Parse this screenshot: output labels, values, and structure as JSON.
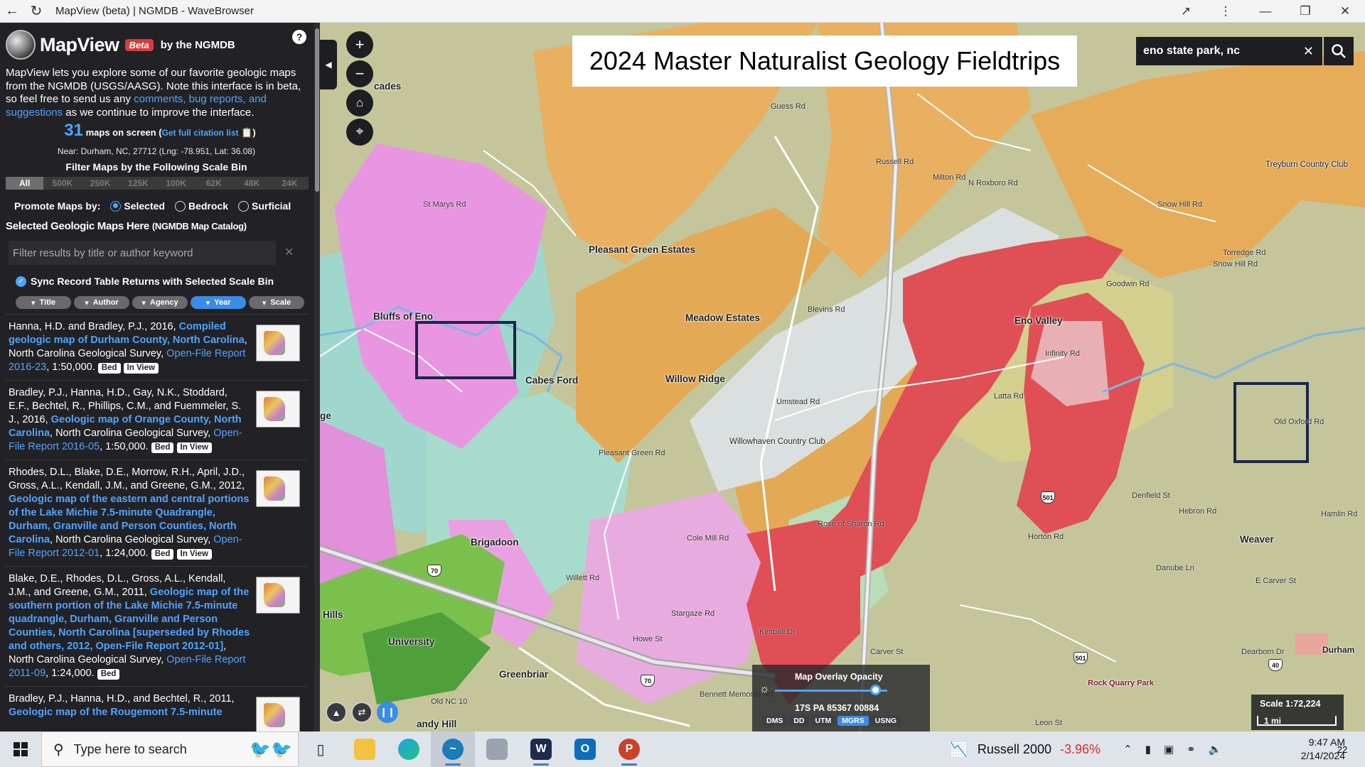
{
  "browser": {
    "title": "MapView (beta) | NGMDB - WaveBrowser"
  },
  "sidebar": {
    "brand": "MapView",
    "beta": "Beta",
    "by": "by the NGMDB",
    "intro_1": "MapView lets you explore some of our favorite geologic maps from the NGMDB (USGS/AASG). Note this interface is in beta, so feel free to send us any ",
    "intro_link": "comments, bug reports, and suggestions",
    "intro_2": " as we continue to improve the interface.",
    "maps_count": "31",
    "maps_label": "maps on screen (",
    "citation_link": "Get full citation list",
    "maps_close": ")",
    "near": "Near: Durham, NC, 27712 (Lng: -78.951, Lat: 36.08)",
    "filter_title": "Filter Maps by the Following Scale Bin",
    "scale_bins": [
      "All",
      "500K",
      "250K",
      "125K",
      "100K",
      "62K",
      "48K",
      "24K"
    ],
    "promote_label": "Promote Maps by:",
    "promote_options": [
      "Selected",
      "Bedrock",
      "Surficial"
    ],
    "selected_heading": "Selected Geologic Maps Here",
    "selected_sub": "(NGMDB Map Catalog)",
    "filter_placeholder": "Filter results by title or author keyword",
    "sync_label": "Sync Record Table Returns with Selected Scale Bin",
    "sort_buttons": [
      "Title",
      "Author",
      "Agency",
      "Year",
      "Scale"
    ],
    "results": [
      {
        "authors": "Hanna, H.D. and Bradley, P.J., 2016, ",
        "title": "Compiled geologic map of Durham County, North Carolina",
        "agency": ", North Carolina Geological Survey, ",
        "series": "Open-File Report 2016-23",
        "scale": ", 1:50,000.",
        "tags": [
          "Bed",
          "In View"
        ]
      },
      {
        "authors": "Bradley, P.J., Hanna, H.D., Gay, N.K., Stoddard, E.F., Bechtel, R., Phillips, C.M., and Fuemmeler, S. J., 2016, ",
        "title": "Geologic map of Orange County, North Carolina",
        "agency": ", North Carolina Geological Survey, ",
        "series": "Open-File Report 2016-05",
        "scale": ", 1:50,000.",
        "tags": [
          "Bed",
          "In View"
        ]
      },
      {
        "authors": "Rhodes, D.L., Blake, D.E., Morrow, R.H., April, J.D., Gross, A.L., Kendall, J.M., and Greene, G.M., 2012, ",
        "title": "Geologic map of the eastern and central portions of the Lake Michie 7.5-minute Quadrangle, Durham, Granville and Person Counties, North Carolina",
        "agency": ", North Carolina Geological Survey, ",
        "series": "Open-File Report 2012-01",
        "scale": ", 1:24,000.",
        "tags": [
          "Bed",
          "In View"
        ]
      },
      {
        "authors": "Blake, D.E., Rhodes, D.L., Gross, A.L., Kendall, J.M., and Greene, G.M., 2011, ",
        "title": "Geologic map of the southern portion of the Lake Michie 7.5-minute quadrangle, Durham, Granville and Person Counties, North Carolina [superseded by Rhodes and others, 2012, Open-File Report 2012-01]",
        "agency": ", North Carolina Geological Survey, ",
        "series": "Open-File Report 2011-09",
        "scale": ", 1:24,000.",
        "tags": [
          "Bed"
        ]
      },
      {
        "authors": "Bradley, P.J., Hanna, H.D., and Bechtel, R., 2011, ",
        "title": "Geologic map of the Rougemont 7.5-minute",
        "agency": "",
        "series": "",
        "scale": "",
        "tags": []
      }
    ]
  },
  "map": {
    "title": "2024 Master Naturalist Geology Fieldtrips",
    "search_value": "eno state park, nc",
    "places": [
      "Bluffs of Eno",
      "Cabes Ford",
      "Pleasant Green Estates",
      "Meadow Estates",
      "Willow Ridge",
      "Eno Valley",
      "Treyburn Country Club",
      "Willowhaven Country Club",
      "Brigadoon",
      "Weaver",
      "Hills",
      "University",
      "Greenbriar",
      "Durham",
      "Rock Quarry Park",
      "andy Hill",
      "ge",
      "cades"
    ],
    "roads": [
      "St Marys Rd",
      "Guess Rd",
      "Russell Rd",
      "Milton Rd",
      "N Roxboro Rd",
      "Snow Hill Rd",
      "Torredge Rd",
      "Goodwin Rd",
      "Umstead Rd",
      "Latta Rd",
      "Infinity Rd",
      "Hebron Rd",
      "Old Oxford Rd",
      "Horton Rd",
      "E Carver St",
      "Carver St",
      "Cole Mill Rd",
      "Rose of Sharon Rd",
      "Willett Rd",
      "Howe St",
      "Bennett Memorial Rd",
      "Old NC 10",
      "Kimball Dr",
      "Stargaze Rd",
      "Dearborn Dr",
      "Leon St",
      "Blevins Rd",
      "Pleasant Green Rd",
      "Snow Hill Rd",
      "Hamlin Rd",
      "Danube Ln",
      "Denfield St"
    ],
    "shields": [
      "70",
      "70",
      "501",
      "501",
      "40"
    ],
    "opacity_label": "Map Overlay Opacity",
    "opacity_value": 0.85,
    "mgrs": "17S PA 85367 00884",
    "coord_formats": [
      "DMS",
      "DD",
      "UTM",
      "MGRS",
      "USNG"
    ],
    "active_coord": "MGRS",
    "scale_text": "Scale 1:72,224",
    "scale_bar": "1 mi"
  },
  "taskbar": {
    "search_placeholder": "Type here to search",
    "ticker_name": "Russell 2000",
    "ticker_change": "-3.96%",
    "time": "9:47 AM",
    "date": "2/14/2024",
    "notifications": "22"
  }
}
